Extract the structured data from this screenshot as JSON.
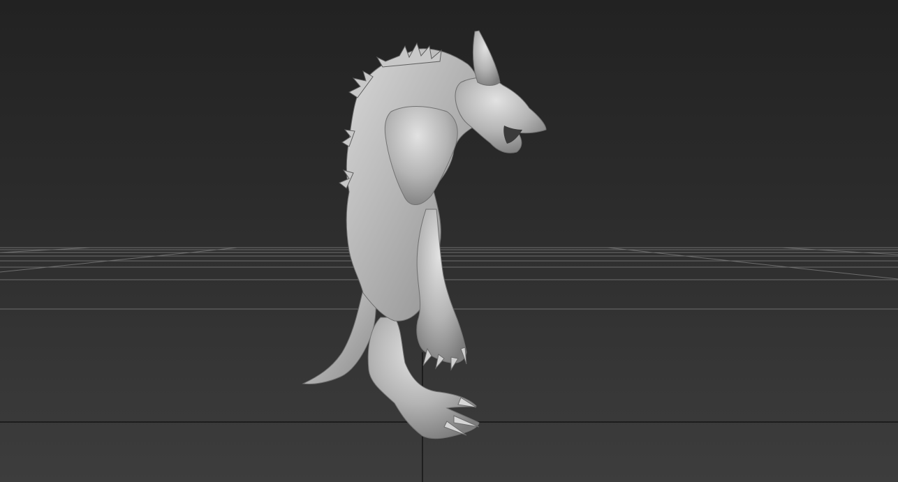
{
  "viewport": {
    "view": "perspective",
    "shading": "default shading",
    "grid": "on",
    "colors": {
      "background_top": "#222222",
      "background_bottom": "#3d3d3d",
      "grid_line": "#6a6a6a",
      "axis_line": "#0a0a0a",
      "model": "#b9b9b9"
    }
  },
  "model": {
    "subject": "werewolf-sculpt",
    "material": "clay"
  }
}
